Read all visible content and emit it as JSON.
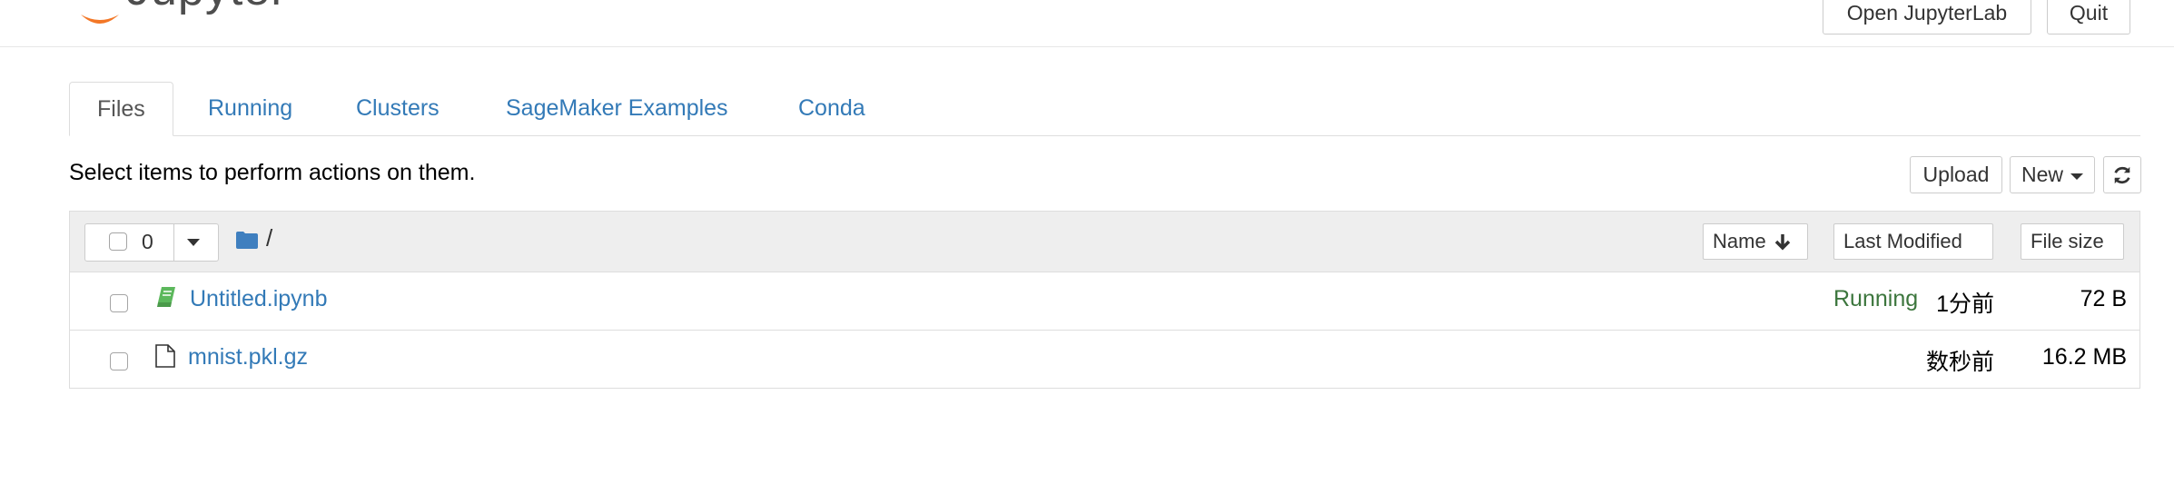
{
  "header": {
    "logo_text": "Jupyter",
    "open_jupyterlab_label": "Open JupyterLab",
    "quit_label": "Quit"
  },
  "tabs": [
    {
      "label": "Files",
      "active": true
    },
    {
      "label": "Running"
    },
    {
      "label": "Clusters"
    },
    {
      "label": "SageMaker Examples"
    },
    {
      "label": "Conda"
    }
  ],
  "toolbar": {
    "select_message": "Select items to perform actions on them.",
    "upload_label": "Upload",
    "new_label": "New"
  },
  "list_header": {
    "selected_count": "0",
    "path": "/",
    "sort_name_label": "Name",
    "sort_modified_label": "Last Modified",
    "sort_size_label": "File size"
  },
  "files": [
    {
      "name": "Untitled.ipynb",
      "type": "notebook",
      "status": "Running",
      "modified": "1分前",
      "size": "72 B"
    },
    {
      "name": "mnist.pkl.gz",
      "type": "file",
      "status": "",
      "modified": "数秒前",
      "size": "16.2 MB"
    }
  ],
  "colors": {
    "link": "#337ab7",
    "running": "#3c763d",
    "notebook_icon": "#5cb85c",
    "folder_icon": "#3f7fbf",
    "logo_orange": "#f37726"
  },
  "icons": {
    "folder": "folder-icon",
    "notebook": "notebook-icon",
    "file": "file-icon",
    "refresh": "refresh-icon",
    "sort": "arrow-down-icon"
  }
}
